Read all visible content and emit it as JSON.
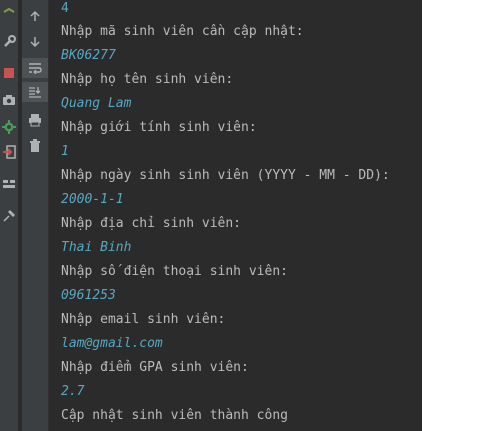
{
  "colors": {
    "console_bg": "#2b2b2b",
    "toolbar_bg": "#3c3f41",
    "output_text": "#bbbbbb",
    "user_input_text": "#56a8c2"
  },
  "left_strip_icons": [
    "wrench-icon",
    "stop-icon",
    "camera-icon",
    "gear-icon",
    "exit-icon",
    "layout-icon",
    "pin-icon"
  ],
  "console_toolbar_icons": [
    "up-arrow-icon",
    "down-arrow-icon",
    "soft-wrap-icon",
    "scroll-to-end-icon",
    "print-icon",
    "trash-icon"
  ],
  "console": {
    "lines": [
      {
        "kind": "input",
        "text": "4"
      },
      {
        "kind": "output",
        "text": "Nhập mã sinh viên cần cập nhật:"
      },
      {
        "kind": "input",
        "text": "BK06277"
      },
      {
        "kind": "output",
        "text": "Nhập họ tên sinh viên:"
      },
      {
        "kind": "input",
        "text": "Quang Lam"
      },
      {
        "kind": "output",
        "text": "Nhập giới tính sinh viên:"
      },
      {
        "kind": "input",
        "text": "1"
      },
      {
        "kind": "output",
        "text": "Nhập ngày sinh sinh viên (YYYY - MM - DD):"
      },
      {
        "kind": "input",
        "text": "2000-1-1"
      },
      {
        "kind": "output",
        "text": "Nhập địa chỉ sinh viên:"
      },
      {
        "kind": "input",
        "text": "Thai Binh"
      },
      {
        "kind": "output",
        "text": "Nhập số điện thoại sinh viên:"
      },
      {
        "kind": "input",
        "text": "0961253"
      },
      {
        "kind": "output",
        "text": "Nhập email sinh viên:"
      },
      {
        "kind": "input",
        "text": "lam@gmail.com"
      },
      {
        "kind": "output",
        "text": "Nhập điểm GPA sinh viên:"
      },
      {
        "kind": "input",
        "text": "2.7"
      },
      {
        "kind": "output",
        "text": "Cập nhật sinh viên thành công"
      }
    ]
  }
}
